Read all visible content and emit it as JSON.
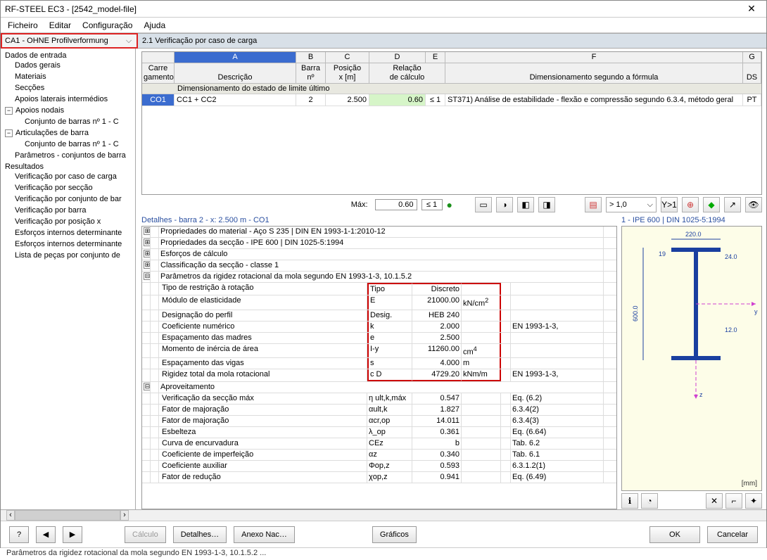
{
  "window": {
    "title": "RF-STEEL EC3 - [2542_model-file]",
    "close": "✕"
  },
  "menu": {
    "file": "Ficheiro",
    "edit": "Editar",
    "config": "Configuração",
    "help": "Ajuda"
  },
  "combo": {
    "value": "CA1 - OHNE Profilverformung"
  },
  "panel": {
    "title": "2.1 Verificação por caso de carga"
  },
  "tree": {
    "root1": "Dados de entrada",
    "n1": "Dados gerais",
    "n2": "Materiais",
    "n3": "Secções",
    "n4": "Apoios laterais intermédios",
    "n5": "Apoios nodais",
    "n5a": "Conjunto de barras nº 1 - C",
    "n6": "Articulações de barra",
    "n6a": "Conjunto de barras nº 1 - C",
    "n7": "Parâmetros - conjuntos de barra",
    "root2": "Resultados",
    "r1": "Verificação por caso de carga",
    "r2": "Verificação por secção",
    "r3": "Verificação por conjunto de bar",
    "r4": "Verificação por barra",
    "r5": "Verificação por posição x",
    "r6": "Esforços internos determinante",
    "r7": "Esforços internos determinante",
    "r8": "Lista de peças por conjunto de"
  },
  "grid": {
    "letters": [
      "",
      "A",
      "B",
      "C",
      "D",
      "E",
      "F",
      "G"
    ],
    "head": {
      "carreg1": "Carre",
      "carreg2": "gamento",
      "descr": "Descrição",
      "barra1": "Barra",
      "barra2": "nº",
      "pos1": "Posição",
      "pos2": "x [m]",
      "rel1": "Relação",
      "rel2": "de cálculo",
      "formula": "Dimensionamento segundo a fórmula",
      "ds": "DS"
    },
    "group": "Dimensionamento do estado de limite último",
    "row": {
      "co1": "CO1",
      "descr": "CC1 + CC2",
      "bar": "2",
      "x": "2.500",
      "ratio": "0.60",
      "le": "≤ 1",
      "formula": "ST371) Análise de estabilidade - flexão e compressão segundo 6.3.4, método geral",
      "ds": "PT"
    },
    "max": {
      "label": "Máx:",
      "val": "0.60",
      "le": "≤ 1"
    }
  },
  "seldd": {
    "value": "> 1,0"
  },
  "details": {
    "title": "Detalhes - barra 2 - x: 2.500 m - CO1",
    "rows": [
      {
        "exp": "⊞",
        "lbl": "Propriedades do material - Aço S 235 | DIN EN 1993-1-1:2010-12"
      },
      {
        "exp": "⊞",
        "lbl": "Propriedades da secção  -  IPE 600 | DIN 1025-5:1994"
      },
      {
        "exp": "⊞",
        "lbl": "Esforços de cálculo"
      },
      {
        "exp": "⊞",
        "lbl": "Classificação da secção - classe 1"
      },
      {
        "exp": "⊟",
        "lbl": "Parâmetros da rigidez rotacional da mola segundo EN 1993-1-3, 10.1.5.2"
      },
      {
        "ind": 1,
        "lbl": "Tipo de restrição à rotação",
        "sym": "Tipo",
        "val": "Discreto",
        "red": 1
      },
      {
        "ind": 1,
        "lbl": "Módulo de elasticidade",
        "sym": "E",
        "val": "21000.00",
        "unit": "kN/cm",
        "sup": "2",
        "red": 1
      },
      {
        "ind": 1,
        "lbl": "Designação do perfil",
        "sym": "Desig.",
        "val": "HEB 240",
        "red": 1
      },
      {
        "ind": 1,
        "lbl": "Coeficiente numérico",
        "sym": "k",
        "val": "2.000",
        "ref": "EN 1993-1-3,",
        "red": 1
      },
      {
        "ind": 1,
        "lbl": "Espaçamento das madres",
        "sym": "e",
        "val": "2.500",
        "red": 1
      },
      {
        "ind": 1,
        "lbl": "Momento de inércia de área",
        "sym": "I-y",
        "val": "11260.00",
        "unit": "cm",
        "sup": "4",
        "red": 1
      },
      {
        "ind": 1,
        "lbl": "Espaçamento das vigas",
        "sym": "s",
        "val": "4.000",
        "unit": "m",
        "red": 1
      },
      {
        "ind": 1,
        "lbl": "Rigidez total da mola rotacional",
        "sym": "c D",
        "val": "4729.20",
        "unit": "kNm/m",
        "ref": "EN 1993-1-3,",
        "red": 1
      },
      {
        "exp": "⊟",
        "lbl": "Aproveitamento"
      },
      {
        "ind": 1,
        "lbl": "Verificação da secção máx",
        "sym": "η ult,k,máx",
        "val": "0.547",
        "ref": "Eq. (6.2)"
      },
      {
        "ind": 1,
        "lbl": "Fator de majoração",
        "sym": "αult,k",
        "val": "1.827",
        "ref": "6.3.4(2)"
      },
      {
        "ind": 1,
        "lbl": "Fator de majoração",
        "sym": "αcr,op",
        "val": "14.011",
        "ref": "6.3.4(3)"
      },
      {
        "ind": 1,
        "lbl": "Esbelteza",
        "sym": "λ_op",
        "val": "0.361",
        "ref": "Eq. (6.64)"
      },
      {
        "ind": 1,
        "lbl": "Curva de encurvadura",
        "sym": "CEz",
        "val": "b",
        "ref": "Tab. 6.2"
      },
      {
        "ind": 1,
        "lbl": "Coeficiente de imperfeição",
        "sym": "αz",
        "val": "0.340",
        "ref": "Tab. 6.1"
      },
      {
        "ind": 1,
        "lbl": "Coeficiente auxiliar",
        "sym": "Φop,z",
        "val": "0.593",
        "ref": "6.3.1.2(1)"
      },
      {
        "ind": 1,
        "lbl": "Fator de redução",
        "sym": "χop,z",
        "val": "0.941",
        "ref": "Eq. (6.49)"
      }
    ]
  },
  "preview": {
    "title": "1 - IPE 600 | DIN 1025-5:1994",
    "mm": "[mm]",
    "d220": "220.0",
    "d19": "19",
    "d24": "24.0",
    "d600": "600.0",
    "d12": "12.0",
    "y": "y",
    "z": "z"
  },
  "footer": {
    "calc": "Cálculo",
    "det": "Detalhes…",
    "anexo": "Anexo Nac…",
    "graf": "Gráficos",
    "ok": "OK",
    "cancel": "Cancelar"
  },
  "status": "Parâmetros da rigidez rotacional da mola segundo EN 1993-1-3, 10.1.5.2 ..."
}
